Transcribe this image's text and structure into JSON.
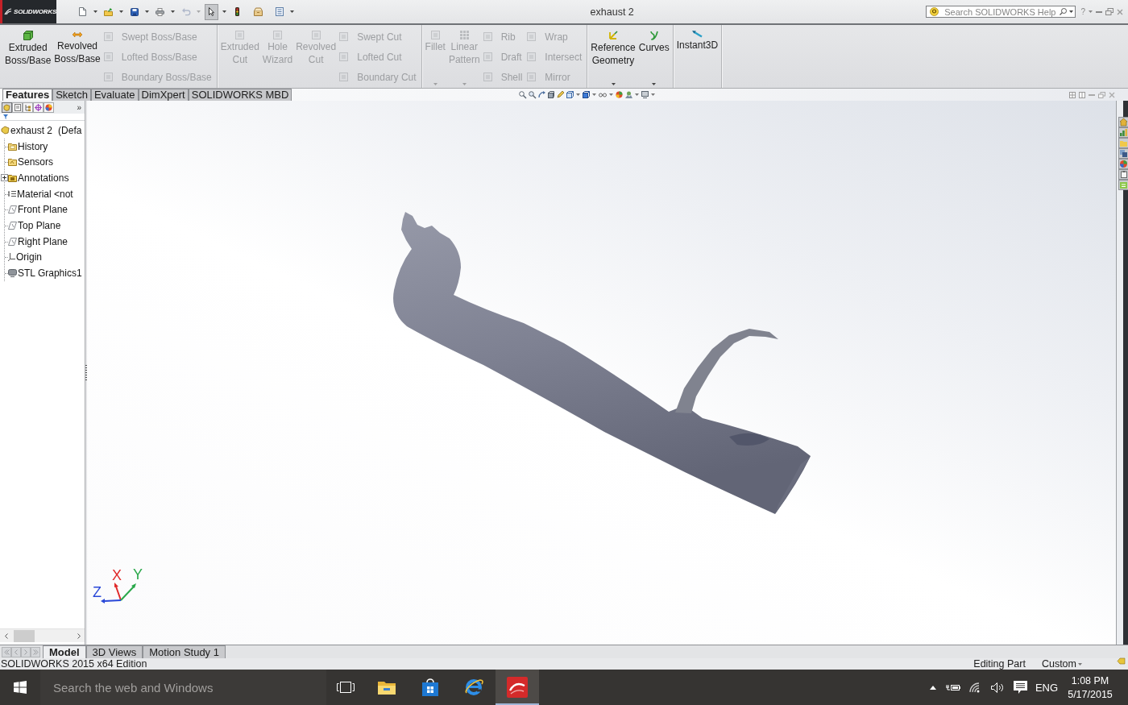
{
  "title_bar": {
    "logo": "SOLIDWORKS",
    "quick_access": [
      {
        "kind": "new",
        "dropdown": true,
        "disabled": false,
        "pressed": false
      },
      {
        "kind": "open",
        "dropdown": true,
        "disabled": false,
        "pressed": false
      },
      {
        "kind": "save",
        "dropdown": true,
        "disabled": false,
        "pressed": false
      },
      {
        "kind": "print",
        "dropdown": true,
        "disabled": false,
        "pressed": false
      },
      {
        "kind": "undo",
        "dropdown": true,
        "disabled": true,
        "pressed": false
      },
      {
        "kind": "select",
        "dropdown": true,
        "disabled": false,
        "pressed": true
      },
      {
        "kind": "rebuild",
        "dropdown": false,
        "disabled": false,
        "pressed": false
      },
      {
        "kind": "file-properties",
        "dropdown": false,
        "disabled": false,
        "pressed": false
      },
      {
        "kind": "options",
        "dropdown": true,
        "disabled": false,
        "pressed": false
      }
    ],
    "document_title": "exhaust 2",
    "help_search": {
      "placeholder": "Search SOLIDWORKS Help"
    },
    "help_button": "?"
  },
  "command_manager": {
    "groups": [
      {
        "large": [
          {
            "label": "Extruded Boss/Base",
            "kind": "extrude",
            "disabled": false,
            "dropdown": false
          },
          {
            "label": "Revolved Boss/Base",
            "kind": "revolve",
            "disabled": false,
            "dropdown": false
          }
        ],
        "small_columns": [
          [
            {
              "label": "Swept Boss/Base",
              "disabled": true
            },
            {
              "label": "Lofted Boss/Base",
              "disabled": true
            },
            {
              "label": "Boundary Boss/Base",
              "disabled": true
            }
          ]
        ]
      },
      {
        "large": [
          {
            "label": "Extruded Cut",
            "kind": "cut",
            "disabled": true,
            "dropdown": false
          },
          {
            "label": "Hole Wizard",
            "kind": "hole",
            "disabled": true,
            "dropdown": false
          },
          {
            "label": "Revolved Cut",
            "kind": "cut",
            "disabled": true,
            "dropdown": false
          }
        ],
        "small_columns": [
          [
            {
              "label": "Swept Cut",
              "disabled": true
            },
            {
              "label": "Lofted Cut",
              "disabled": true
            },
            {
              "label": "Boundary Cut",
              "disabled": true
            }
          ]
        ]
      },
      {
        "large": [
          {
            "label": "Fillet",
            "kind": "fillet",
            "disabled": true,
            "dropdown": true
          },
          {
            "label": "Linear Pattern",
            "kind": "pattern",
            "disabled": true,
            "dropdown": true
          }
        ],
        "small_columns": [
          [
            {
              "label": "Rib",
              "disabled": true
            },
            {
              "label": "Draft",
              "disabled": true
            },
            {
              "label": "Shell",
              "disabled": true
            }
          ],
          [
            {
              "label": "Wrap",
              "disabled": true
            },
            {
              "label": "Intersect",
              "disabled": true
            },
            {
              "label": "Mirror",
              "disabled": true
            }
          ]
        ]
      },
      {
        "large": [
          {
            "label": "Reference Geometry",
            "kind": "reference",
            "disabled": false,
            "dropdown": true
          },
          {
            "label": "Curves",
            "kind": "curves",
            "disabled": false,
            "dropdown": true
          }
        ]
      },
      {
        "large": [
          {
            "label": "Instant3D",
            "kind": "instant3d",
            "disabled": false,
            "dropdown": false
          }
        ]
      }
    ],
    "tabs": [
      {
        "label": "Features",
        "selected": true
      },
      {
        "label": "Sketch",
        "selected": false
      },
      {
        "label": "Evaluate",
        "selected": false
      },
      {
        "label": "DimXpert",
        "selected": false
      },
      {
        "label": "SOLIDWORKS MBD",
        "selected": false
      }
    ]
  },
  "feature_manager": {
    "tabs": [
      {
        "kind": "feature-tree",
        "selected": true
      },
      {
        "kind": "properties",
        "selected": false
      },
      {
        "kind": "configurations",
        "selected": false
      },
      {
        "kind": "dimxpert",
        "selected": false
      },
      {
        "kind": "display",
        "selected": false
      }
    ],
    "more": "»",
    "tree": {
      "label": "exhaust 2",
      "configuration": "(Defa",
      "kind": "part",
      "children": [
        {
          "label": "History",
          "kind": "history"
        },
        {
          "label": "Sensors",
          "kind": "sensors"
        },
        {
          "label": "Annotations",
          "kind": "annotations",
          "expanded": false
        },
        {
          "label": "Material <not",
          "kind": "material"
        },
        {
          "label": "Front Plane",
          "kind": "plane"
        },
        {
          "label": "Top Plane",
          "kind": "plane"
        },
        {
          "label": "Right Plane",
          "kind": "plane"
        },
        {
          "label": "Origin",
          "kind": "origin"
        },
        {
          "label": "STL Graphics1",
          "kind": "mesh"
        }
      ]
    }
  },
  "graphics_area": {
    "triad": {
      "x": "X",
      "y": "Y",
      "z": "Z"
    }
  },
  "bottom_tabs": [
    {
      "label": "Model",
      "selected": true
    },
    {
      "label": "3D Views",
      "selected": false
    },
    {
      "label": "Motion Study 1",
      "selected": false
    }
  ],
  "status_bar": {
    "edition": "SOLIDWORKS 2015 x64 Edition",
    "mode": "Editing Part",
    "units": "Custom"
  },
  "taskbar": {
    "search": {
      "placeholder": "Search the web and Windows"
    },
    "apps": [
      {
        "kind": "file-explorer",
        "active": false
      },
      {
        "kind": "store",
        "active": false
      },
      {
        "kind": "internet-explorer",
        "active": false
      },
      {
        "kind": "solidworks",
        "active": true
      }
    ],
    "tray": {
      "language": "ENG",
      "time": "1:08 PM",
      "date": "5/17/2015"
    }
  }
}
